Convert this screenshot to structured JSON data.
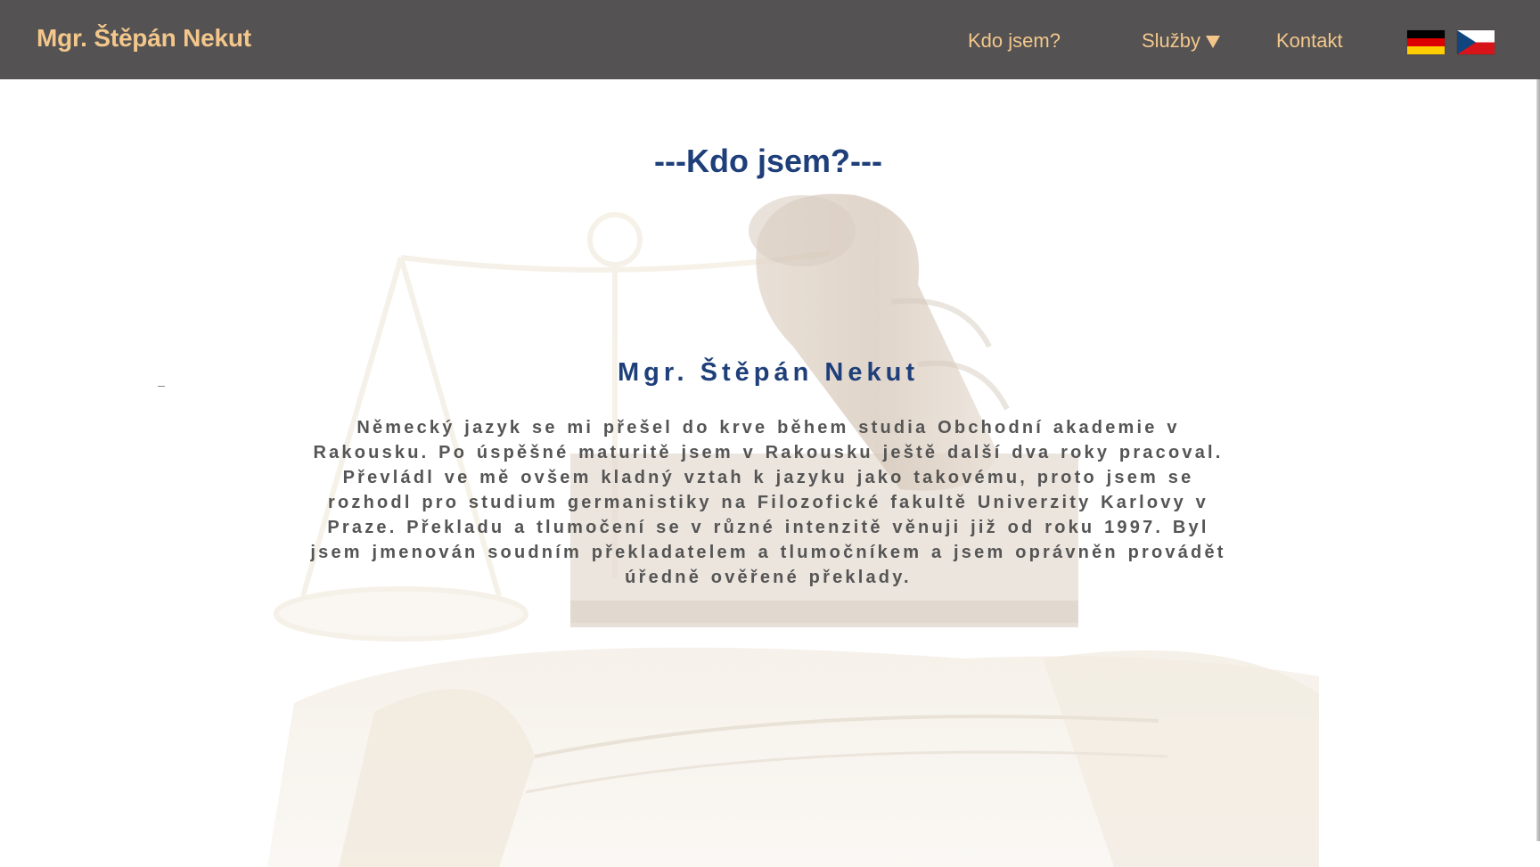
{
  "header": {
    "brand": "Mgr. Štěpán Nekut",
    "nav": {
      "who": "Kdo jsem?",
      "services": "Služby",
      "contact": "Kontakt"
    },
    "languages": [
      {
        "name": "Deutsch",
        "icon": "german-flag-icon"
      },
      {
        "name": "Čeština",
        "icon": "czech-flag-icon"
      }
    ]
  },
  "main": {
    "section_title": "---Kdo jsem?---",
    "name": "Mgr. Štěpán Nekut",
    "bio": "Německý jazyk se mi přešel do krve během studia Obchodní akademie v Rakousku. Po úspěšné maturitě jsem v Rakousku ještě další dva roky pracoval. Převládl ve mě ovšem kladný vztah k jazyku jako takovému, proto jsem se rozhodl pro studium germanistiky na Filozofické fakultě Univerzity Karlovy v Praze. Překladu a tlumočení se v různé intenzitě věnuji již od roku 1997. Byl jsem jmenován soudním překladatelem a tlumočníkem a jsem oprávněn provádět úředně ověřené překlady."
  },
  "colors": {
    "header_bg": "#545252",
    "accent_text": "#f3c78c",
    "title": "#1e3f7a",
    "body_text": "#555555"
  }
}
